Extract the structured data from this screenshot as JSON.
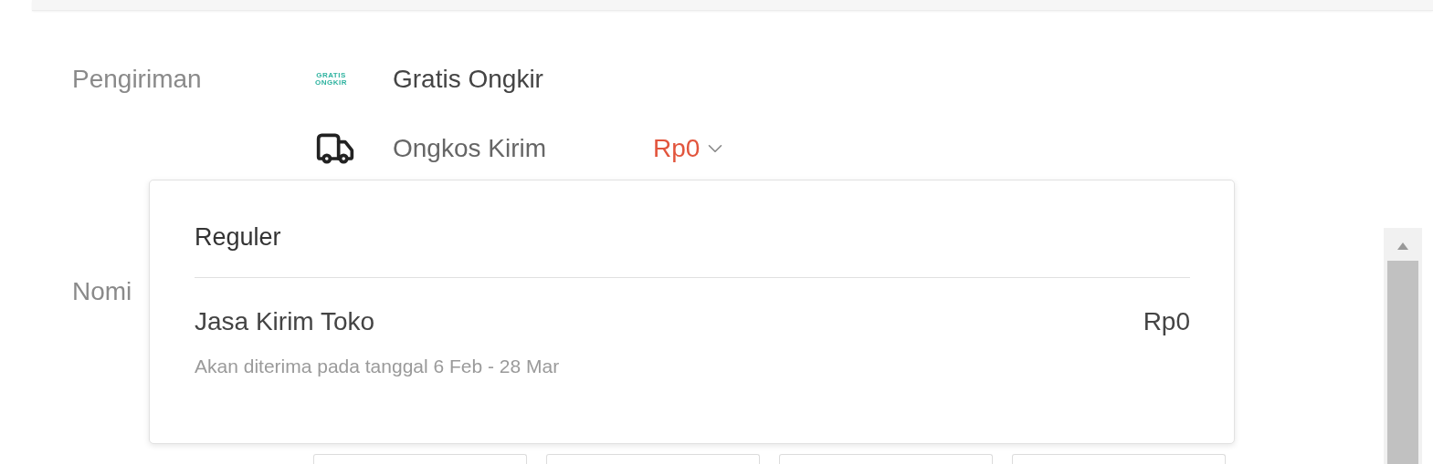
{
  "shipping": {
    "label": "Pengiriman",
    "badge_lines": [
      "GRATIS",
      "ONGKIR"
    ],
    "free_shipping": "Gratis Ongkir",
    "cost_label": "Ongkos Kirim",
    "cost_value": "Rp0"
  },
  "next_label": "Nomi",
  "dropdown": {
    "group": "Reguler",
    "options": [
      {
        "name": "Jasa Kirim Toko",
        "price": "Rp0",
        "eta": "Akan diterima pada tanggal 6 Feb - 28 Mar"
      }
    ]
  }
}
